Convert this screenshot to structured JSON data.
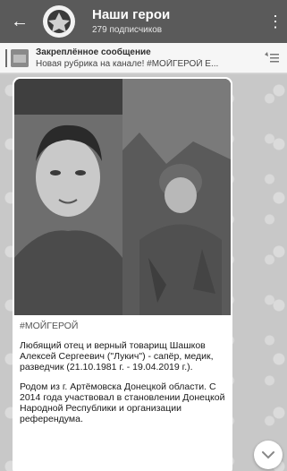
{
  "header": {
    "back_icon": "back-arrow-icon",
    "title": "Наши герои",
    "subtitle": "279 подписчиков",
    "menu_icon": "more-vert-icon"
  },
  "pinned": {
    "title": "Закреплённое сообщение",
    "text": "Новая рубрика на канале! #МОЙГЕРОЙ Е...",
    "icon": "pinned-list-icon"
  },
  "message": {
    "hashtag": "#МОЙГЕРОЙ",
    "paragraph1": "Любящий отец и верный товарищ Шашков Алексей Сергеевич (\"Лукич\") - сапёр, медик, разведчик (21.10.1981 г. - 19.04.2019 г.).",
    "paragraph2": "Родом из г. Артёмовска Донецкой области. С 2014 года участвовал в становлении Донецкой Народной Республики и организации референдума."
  },
  "scroll_icon": "chevron-down-icon"
}
